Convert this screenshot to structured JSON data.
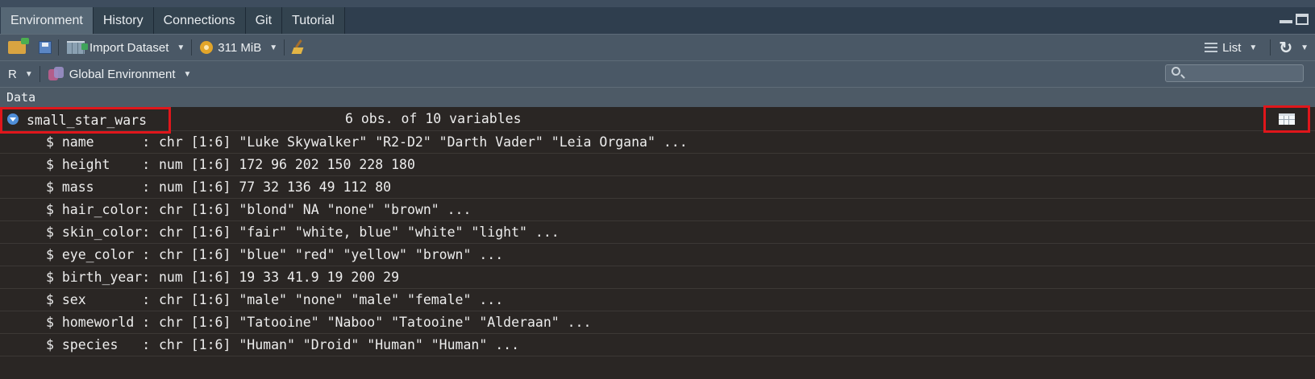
{
  "tabs": [
    "Environment",
    "History",
    "Connections",
    "Git",
    "Tutorial"
  ],
  "toolbar": {
    "import_label": "Import Dataset",
    "memory_label": "311 MiB",
    "view_mode_label": "List"
  },
  "envbar": {
    "language": "R",
    "environment": "Global Environment",
    "search_placeholder": ""
  },
  "section_title": "Data",
  "object": {
    "name": "small_star_wars",
    "summary": "6 obs. of 10 variables"
  },
  "variables": [
    {
      "name": "$ name      :",
      "value": "chr [1:6] \"Luke Skywalker\" \"R2-D2\" \"Darth Vader\" \"Leia Organa\" ..."
    },
    {
      "name": "$ height    :",
      "value": "num [1:6] 172 96 202 150 228 180"
    },
    {
      "name": "$ mass      :",
      "value": "num [1:6] 77 32 136 49 112 80"
    },
    {
      "name": "$ hair_color:",
      "value": "chr [1:6] \"blond\" NA \"none\" \"brown\" ..."
    },
    {
      "name": "$ skin_color:",
      "value": "chr [1:6] \"fair\" \"white, blue\" \"white\" \"light\" ..."
    },
    {
      "name": "$ eye_color :",
      "value": "chr [1:6] \"blue\" \"red\" \"yellow\" \"brown\" ..."
    },
    {
      "name": "$ birth_year:",
      "value": "num [1:6] 19 33 41.9 19 200 29"
    },
    {
      "name": "$ sex       :",
      "value": "chr [1:6] \"male\" \"none\" \"male\" \"female\" ..."
    },
    {
      "name": "$ homeworld :",
      "value": "chr [1:6] \"Tatooine\" \"Naboo\" \"Tatooine\" \"Alderaan\" ..."
    },
    {
      "name": "$ species   :",
      "value": "chr [1:6] \"Human\" \"Droid\" \"Human\" \"Human\" ..."
    }
  ],
  "colors": {
    "highlight": "#e0161b",
    "panel_bg": "#2a2624",
    "toolbar_bg": "#4a5866",
    "tab_active": "#566775"
  }
}
